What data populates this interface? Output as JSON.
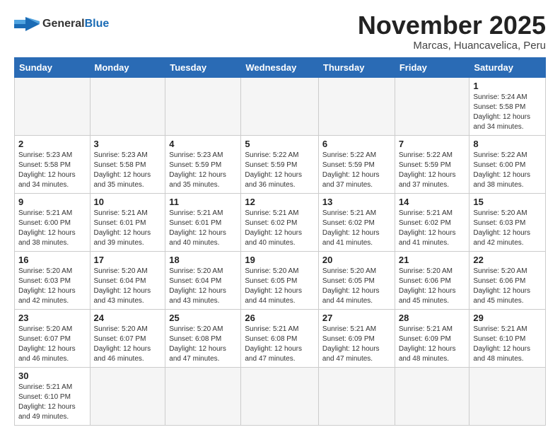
{
  "logo": {
    "general": "General",
    "blue": "Blue"
  },
  "title": "November 2025",
  "subtitle": "Marcas, Huancavelica, Peru",
  "days_header": [
    "Sunday",
    "Monday",
    "Tuesday",
    "Wednesday",
    "Thursday",
    "Friday",
    "Saturday"
  ],
  "weeks": [
    [
      {
        "day": "",
        "info": ""
      },
      {
        "day": "",
        "info": ""
      },
      {
        "day": "",
        "info": ""
      },
      {
        "day": "",
        "info": ""
      },
      {
        "day": "",
        "info": ""
      },
      {
        "day": "",
        "info": ""
      },
      {
        "day": "1",
        "info": "Sunrise: 5:24 AM\nSunset: 5:58 PM\nDaylight: 12 hours and 34 minutes."
      }
    ],
    [
      {
        "day": "2",
        "info": "Sunrise: 5:23 AM\nSunset: 5:58 PM\nDaylight: 12 hours and 34 minutes."
      },
      {
        "day": "3",
        "info": "Sunrise: 5:23 AM\nSunset: 5:58 PM\nDaylight: 12 hours and 35 minutes."
      },
      {
        "day": "4",
        "info": "Sunrise: 5:23 AM\nSunset: 5:59 PM\nDaylight: 12 hours and 35 minutes."
      },
      {
        "day": "5",
        "info": "Sunrise: 5:22 AM\nSunset: 5:59 PM\nDaylight: 12 hours and 36 minutes."
      },
      {
        "day": "6",
        "info": "Sunrise: 5:22 AM\nSunset: 5:59 PM\nDaylight: 12 hours and 37 minutes."
      },
      {
        "day": "7",
        "info": "Sunrise: 5:22 AM\nSunset: 5:59 PM\nDaylight: 12 hours and 37 minutes."
      },
      {
        "day": "8",
        "info": "Sunrise: 5:22 AM\nSunset: 6:00 PM\nDaylight: 12 hours and 38 minutes."
      }
    ],
    [
      {
        "day": "9",
        "info": "Sunrise: 5:21 AM\nSunset: 6:00 PM\nDaylight: 12 hours and 38 minutes."
      },
      {
        "day": "10",
        "info": "Sunrise: 5:21 AM\nSunset: 6:01 PM\nDaylight: 12 hours and 39 minutes."
      },
      {
        "day": "11",
        "info": "Sunrise: 5:21 AM\nSunset: 6:01 PM\nDaylight: 12 hours and 40 minutes."
      },
      {
        "day": "12",
        "info": "Sunrise: 5:21 AM\nSunset: 6:02 PM\nDaylight: 12 hours and 40 minutes."
      },
      {
        "day": "13",
        "info": "Sunrise: 5:21 AM\nSunset: 6:02 PM\nDaylight: 12 hours and 41 minutes."
      },
      {
        "day": "14",
        "info": "Sunrise: 5:21 AM\nSunset: 6:02 PM\nDaylight: 12 hours and 41 minutes."
      },
      {
        "day": "15",
        "info": "Sunrise: 5:20 AM\nSunset: 6:03 PM\nDaylight: 12 hours and 42 minutes."
      }
    ],
    [
      {
        "day": "16",
        "info": "Sunrise: 5:20 AM\nSunset: 6:03 PM\nDaylight: 12 hours and 42 minutes."
      },
      {
        "day": "17",
        "info": "Sunrise: 5:20 AM\nSunset: 6:04 PM\nDaylight: 12 hours and 43 minutes."
      },
      {
        "day": "18",
        "info": "Sunrise: 5:20 AM\nSunset: 6:04 PM\nDaylight: 12 hours and 43 minutes."
      },
      {
        "day": "19",
        "info": "Sunrise: 5:20 AM\nSunset: 6:05 PM\nDaylight: 12 hours and 44 minutes."
      },
      {
        "day": "20",
        "info": "Sunrise: 5:20 AM\nSunset: 6:05 PM\nDaylight: 12 hours and 44 minutes."
      },
      {
        "day": "21",
        "info": "Sunrise: 5:20 AM\nSunset: 6:06 PM\nDaylight: 12 hours and 45 minutes."
      },
      {
        "day": "22",
        "info": "Sunrise: 5:20 AM\nSunset: 6:06 PM\nDaylight: 12 hours and 45 minutes."
      }
    ],
    [
      {
        "day": "23",
        "info": "Sunrise: 5:20 AM\nSunset: 6:07 PM\nDaylight: 12 hours and 46 minutes."
      },
      {
        "day": "24",
        "info": "Sunrise: 5:20 AM\nSunset: 6:07 PM\nDaylight: 12 hours and 46 minutes."
      },
      {
        "day": "25",
        "info": "Sunrise: 5:20 AM\nSunset: 6:08 PM\nDaylight: 12 hours and 47 minutes."
      },
      {
        "day": "26",
        "info": "Sunrise: 5:21 AM\nSunset: 6:08 PM\nDaylight: 12 hours and 47 minutes."
      },
      {
        "day": "27",
        "info": "Sunrise: 5:21 AM\nSunset: 6:09 PM\nDaylight: 12 hours and 47 minutes."
      },
      {
        "day": "28",
        "info": "Sunrise: 5:21 AM\nSunset: 6:09 PM\nDaylight: 12 hours and 48 minutes."
      },
      {
        "day": "29",
        "info": "Sunrise: 5:21 AM\nSunset: 6:10 PM\nDaylight: 12 hours and 48 minutes."
      }
    ],
    [
      {
        "day": "30",
        "info": "Sunrise: 5:21 AM\nSunset: 6:10 PM\nDaylight: 12 hours and 49 minutes."
      },
      {
        "day": "",
        "info": ""
      },
      {
        "day": "",
        "info": ""
      },
      {
        "day": "",
        "info": ""
      },
      {
        "day": "",
        "info": ""
      },
      {
        "day": "",
        "info": ""
      },
      {
        "day": "",
        "info": ""
      }
    ]
  ]
}
